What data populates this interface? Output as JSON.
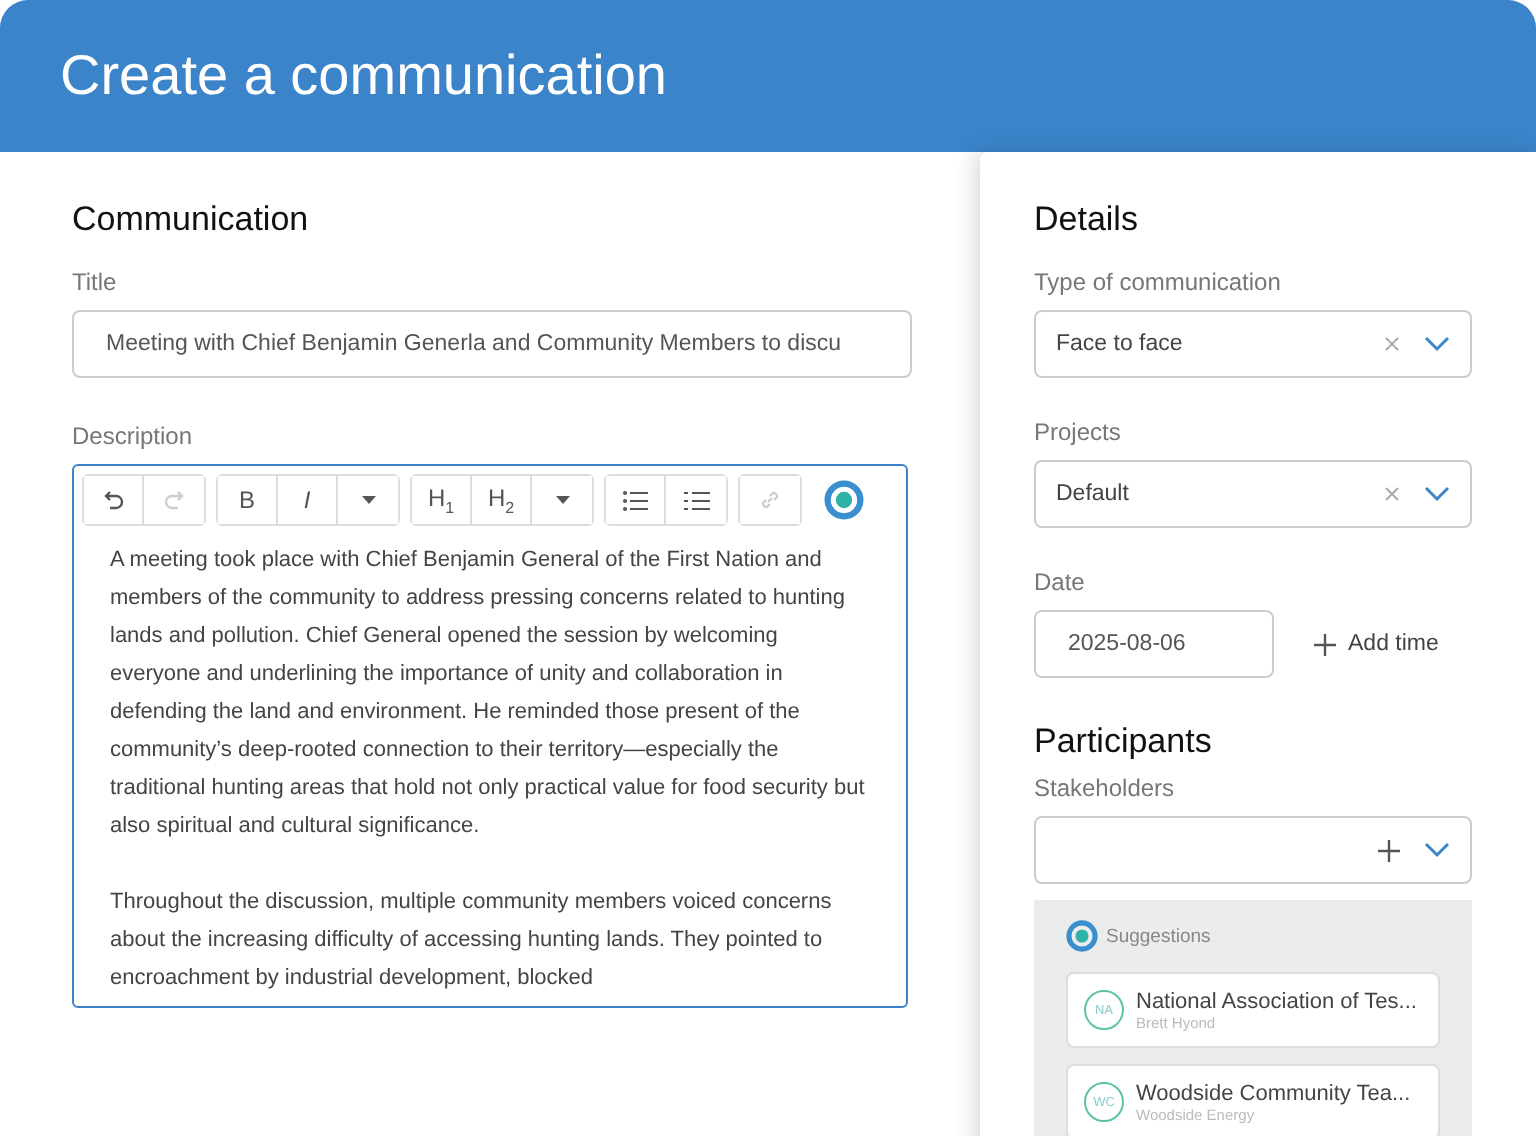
{
  "header": {
    "title": "Create a communication"
  },
  "communication": {
    "heading": "Communication",
    "title_field": {
      "label": "Title",
      "value": "Meeting with Chief Benjamin Generla and Community Members to discu"
    },
    "description": {
      "label": "Description",
      "toolbar": [
        {
          "buttons": [
            {
              "kind": "undo",
              "disabled": false
            },
            {
              "kind": "redo",
              "disabled": true
            }
          ]
        },
        {
          "buttons": [
            {
              "kind": "bold",
              "text": "B",
              "disabled": false
            },
            {
              "kind": "italic",
              "text": "I",
              "disabled": false
            },
            {
              "kind": "dropdown",
              "disabled": false
            }
          ]
        },
        {
          "buttons": [
            {
              "kind": "heading",
              "text": "H$_{1}$",
              "disabled": false
            },
            {
              "kind": "heading",
              "text": "H$_{2}$",
              "disabled": false
            },
            {
              "kind": "dropdown",
              "disabled": false
            }
          ]
        },
        {
          "buttons": [
            {
              "kind": "bullets",
              "disabled": false
            },
            {
              "kind": "numbers",
              "disabled": false
            }
          ]
        },
        {
          "buttons": [
            {
              "kind": "link",
              "disabled": true
            }
          ]
        }
      ],
      "paragraphs": [
        "A meeting took place with Chief Benjamin General of the First Nation and members of the community to address pressing concerns related to hunting lands and pollution. Chief General opened the session by welcoming everyone and underlining the importance of unity and collaboration in defending the land and environment. He reminded those present of the community’s deep-rooted connection to their territory—especially the traditional hunting areas that hold not only practical value for food security but also spiritual and cultural significance.",
        "Throughout the discussion, multiple community members voiced concerns about the increasing difficulty of accessing hunting lands. They pointed to encroachment by industrial development, blocked"
      ]
    }
  },
  "details": {
    "heading": "Details",
    "type": {
      "label": "Type of communication",
      "value": "Face to face"
    },
    "projects": {
      "label": "Projects",
      "value": "Default"
    },
    "date": {
      "label": "Date",
      "value": "2025-08-06",
      "add_time": "Add time"
    }
  },
  "participants": {
    "heading": "Participants",
    "stakeholders_label": "Stakeholders",
    "suggestions_label": "Suggestions",
    "suggestions": [
      {
        "initials": "NA",
        "name": "National Association of Tes...",
        "sub": "Brett Hyond"
      },
      {
        "initials": "WC",
        "name": "Woodside Community Tea...",
        "sub": "Woodside Energy"
      }
    ]
  }
}
